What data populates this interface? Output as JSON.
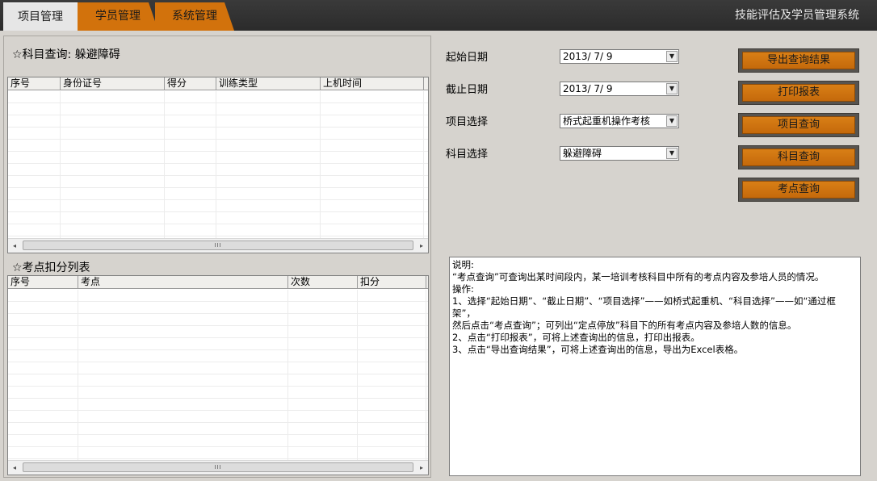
{
  "app_title": "技能评估及学员管理系统",
  "tabs": [
    {
      "label": "项目管理"
    },
    {
      "label": "学员管理"
    },
    {
      "label": "系统管理"
    }
  ],
  "subject_query": {
    "title": "☆科目查询: 躲避障碍",
    "columns": [
      "序号",
      "身份证号",
      "得分",
      "训练类型",
      "上机时间"
    ],
    "rows": []
  },
  "deduction_list": {
    "title": "☆考点扣分列表",
    "columns": [
      "序号",
      "考点",
      "次数",
      "扣分"
    ],
    "rows": []
  },
  "scroll_thumb_glyph": "III",
  "form": {
    "start_date_label": "起始日期",
    "start_date_value": "2013/ 7/ 9",
    "end_date_label": "截止日期",
    "end_date_value": "2013/ 7/ 9",
    "project_label": "项目选择",
    "project_value": "桥式起重机操作考核",
    "subject_label": "科目选择",
    "subject_value": "躲避障碍"
  },
  "buttons": {
    "export": "导出查询结果",
    "print": "打印报表",
    "project_query": "项目查询",
    "subject_query": "科目查询",
    "exam_point_query": "考点查询"
  },
  "instructions": "说明:\n“考点查询”可查询出某时间段内，某一培训考核科目中所有的考点内容及参培人员的情况。\n操作:\n1、选择“起始日期”、“截止日期”、“项目选择”——如桥式起重机、“科目选择”——如“通过框架”，\n然后点击“考点查询”；可列出“定点停放”科目下的所有考点内容及参培人数的信息。\n2、点击“打印报表”，可将上述查询出的信息，打印出报表。\n3、点击“导出查询结果”，可将上述查询出的信息，导出为Excel表格。",
  "colors": {
    "accent_orange": "#d2720c",
    "topbar": "#2f2f2f",
    "panel_bg": "#d6d3ce"
  }
}
